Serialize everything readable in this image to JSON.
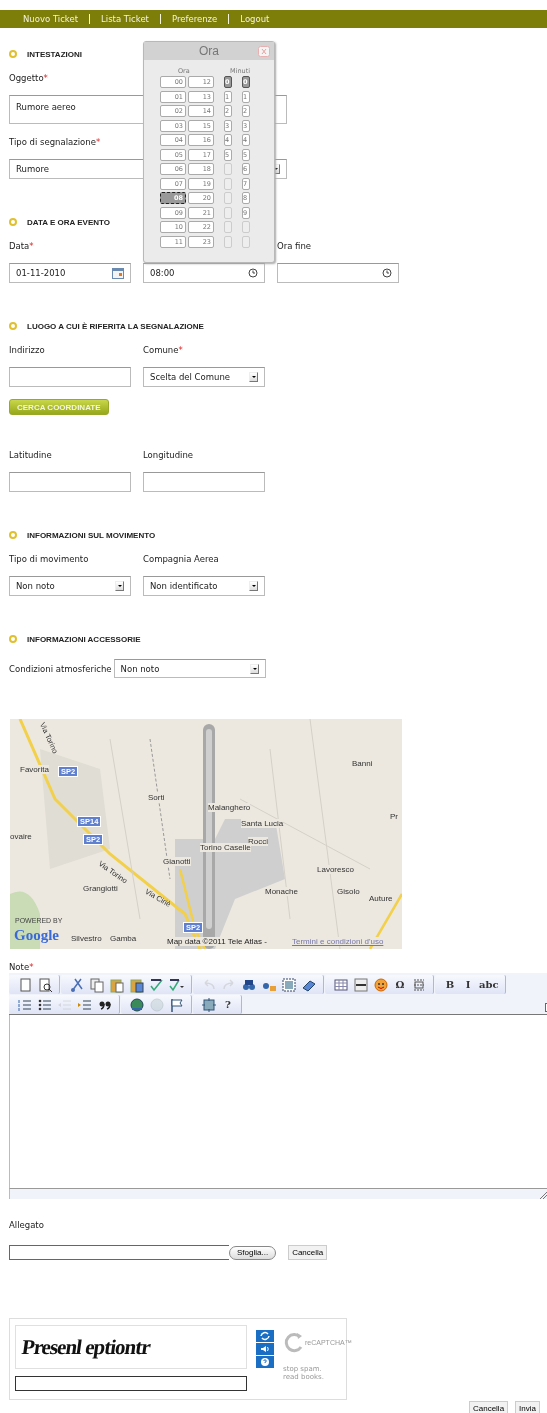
{
  "nav": [
    {
      "label": "Nuovo Ticket"
    },
    {
      "label": "Lista Ticket"
    },
    {
      "label": "Preferenze"
    },
    {
      "label": "Logout"
    }
  ],
  "sections": [
    {
      "title": "INTESTAZIONI",
      "rows": [
        [
          {
            "kind": "textarea",
            "label": "Oggetto",
            "required_mark": "*",
            "value": "Rumore aereo"
          }
        ],
        [
          {
            "kind": "select",
            "wide": true,
            "label": "Tipo di segnalazione",
            "required_mark": "*",
            "value": "Rumore"
          }
        ]
      ]
    },
    {
      "title": "DATA E ORA EVENTO",
      "rows": [
        [
          {
            "kind": "date",
            "label": "Data",
            "required_mark": "*",
            "value": "01-11-2010"
          },
          {
            "kind": "time",
            "value": "08:00"
          },
          {
            "kind": "time",
            "label": "Ora fine"
          }
        ]
      ]
    },
    {
      "title": "LUOGO A CUI È RIFERITA LA SEGNALAZIONE",
      "rows": [
        [
          {
            "kind": "text",
            "label": "Indirizzo"
          },
          {
            "kind": "select",
            "label": "Comune",
            "required_mark": "*",
            "value": "Scelta del Comune"
          }
        ],
        [
          {
            "kind": "button",
            "value": "CERCA COORDINATE"
          }
        ],
        [
          {
            "kind": "text",
            "label": "Latitudine"
          },
          {
            "kind": "text",
            "label": "Longitudine"
          }
        ]
      ]
    },
    {
      "title": "INFORMAZIONI SUL MOVIMENTO",
      "rows": [
        [
          {
            "kind": "select",
            "label": "Tipo di movimento",
            "value": "Non noto"
          },
          {
            "kind": "select",
            "label": "Compagnia Aerea",
            "value": "Non identificato"
          }
        ]
      ]
    },
    {
      "title": "INFORMAZIONI ACCESSORIE",
      "rows": [
        [
          {
            "kind": "inline-select",
            "label": "Condizioni atmosferiche",
            "value": "Non noto"
          }
        ]
      ]
    }
  ],
  "time_picker": {
    "title": "Ora",
    "hours_heading": "Ora",
    "minutes_heading": "Minuti",
    "hours": [
      {
        "label": "00",
        "selected": false
      },
      {
        "label": "01",
        "selected": false
      },
      {
        "label": "02",
        "selected": false
      },
      {
        "label": "03",
        "selected": false
      },
      {
        "label": "04",
        "selected": false
      },
      {
        "label": "05",
        "selected": false
      },
      {
        "label": "06",
        "selected": false
      },
      {
        "label": "07",
        "selected": false
      },
      {
        "label": "08",
        "selected": true
      },
      {
        "label": "09",
        "selected": false
      },
      {
        "label": "10",
        "selected": false
      },
      {
        "label": "11",
        "selected": false
      },
      {
        "label": "12",
        "selected": false
      },
      {
        "label": "13",
        "selected": false
      },
      {
        "label": "14",
        "selected": false
      },
      {
        "label": "15",
        "selected": false
      },
      {
        "label": "16",
        "selected": false
      },
      {
        "label": "17",
        "selected": false
      },
      {
        "label": "18",
        "selected": false
      },
      {
        "label": "19",
        "selected": false
      },
      {
        "label": "20",
        "selected": false
      },
      {
        "label": "21",
        "selected": false
      },
      {
        "label": "22",
        "selected": false
      },
      {
        "label": "23",
        "selected": false
      }
    ],
    "minute_tens": [
      {
        "label": "0",
        "selected": true
      },
      {
        "label": "1",
        "selected": false
      },
      {
        "label": "2",
        "selected": false
      },
      {
        "label": "3",
        "selected": false
      },
      {
        "label": "4",
        "selected": false
      },
      {
        "label": "5",
        "selected": false
      }
    ],
    "minute_units": [
      {
        "label": "0",
        "selected": true
      },
      {
        "label": "1",
        "selected": false
      },
      {
        "label": "2",
        "selected": false
      },
      {
        "label": "3",
        "selected": false
      },
      {
        "label": "4",
        "selected": false
      },
      {
        "label": "5",
        "selected": false
      },
      {
        "label": "6",
        "selected": false
      },
      {
        "label": "7",
        "selected": false
      },
      {
        "label": "8",
        "selected": false
      },
      {
        "label": "9",
        "selected": false
      }
    ]
  },
  "map": {
    "labels": [
      {
        "text": "Favorita",
        "kind": "place"
      },
      {
        "text": "SP2",
        "kind": "road-badge"
      },
      {
        "text": "Sorti",
        "kind": "place"
      },
      {
        "text": "Malanghero",
        "kind": "place"
      },
      {
        "text": "Santa Lucia",
        "kind": "place"
      },
      {
        "text": "Rocci",
        "kind": "place"
      },
      {
        "text": "Torino Caselle",
        "kind": "place"
      },
      {
        "text": "Gianotti",
        "kind": "place"
      },
      {
        "text": "Lavoresco",
        "kind": "place"
      },
      {
        "text": "Grangiotti",
        "kind": "place"
      },
      {
        "text": "Monache",
        "kind": "place"
      },
      {
        "text": "Gisolo",
        "kind": "place"
      },
      {
        "text": "Auture",
        "kind": "place"
      },
      {
        "text": "Banni",
        "kind": "place"
      },
      {
        "text": "SP14",
        "kind": "road-badge"
      },
      {
        "text": "SP2",
        "kind": "road-badge"
      },
      {
        "text": "SP2",
        "kind": "road-badge"
      },
      {
        "text": "Silvestro",
        "kind": "place"
      },
      {
        "text": "Gamba",
        "kind": "place"
      },
      {
        "text": "Via Torino",
        "kind": "road"
      },
      {
        "text": "Via Torino",
        "kind": "road"
      },
      {
        "text": "Via Ciriè",
        "kind": "road"
      },
      {
        "text": "ovaire",
        "kind": "place"
      },
      {
        "text": "Pr",
        "kind": "place"
      }
    ],
    "powered_by": "POWERED BY",
    "logo": "Google",
    "attribution": "Map data ©2011 Tele Atlas - ",
    "terms_link": "Termini e condizioni d'uso"
  },
  "note": {
    "label": "Note",
    "required_mark": "*",
    "toolbar": [
      [
        [
          {
            "kind": "page",
            "disabled": false
          },
          {
            "kind": "preview",
            "disabled": false
          }
        ],
        [
          {
            "kind": "cut",
            "disabled": false
          },
          {
            "kind": "copy",
            "disabled": false
          },
          {
            "kind": "paste",
            "disabled": false
          },
          {
            "kind": "paste-word",
            "disabled": false
          },
          {
            "kind": "spellcheck",
            "disabled": false
          },
          {
            "kind": "spellcheck-menu",
            "disabled": false
          }
        ],
        [
          {
            "kind": "undo",
            "disabled": true
          },
          {
            "kind": "redo",
            "disabled": true
          },
          {
            "kind": "find",
            "disabled": false
          },
          {
            "kind": "replace",
            "disabled": false
          },
          {
            "kind": "select-all",
            "disabled": false
          },
          {
            "kind": "eraser",
            "disabled": false
          }
        ],
        [
          {
            "kind": "table",
            "disabled": false
          },
          {
            "kind": "rule",
            "disabled": false
          },
          {
            "kind": "smiley",
            "disabled": false
          },
          {
            "kind": "char",
            "label": "Ω",
            "disabled": false
          },
          {
            "kind": "page-break",
            "disabled": false
          }
        ],
        [
          {
            "kind": "char",
            "label": "B",
            "disabled": false
          },
          {
            "kind": "char",
            "label": "I",
            "disabled": false
          },
          {
            "kind": "char",
            "label": "abc",
            "disabled": false
          }
        ]
      ],
      [
        [
          {
            "kind": "numbered-list",
            "disabled": false
          },
          {
            "kind": "bullet-list",
            "disabled": false
          },
          {
            "kind": "outdent",
            "disabled": true
          },
          {
            "kind": "indent",
            "disabled": false
          },
          {
            "kind": "quote",
            "disabled": false
          }
        ],
        [
          {
            "kind": "link",
            "disabled": false
          },
          {
            "kind": "unlink",
            "disabled": true
          },
          {
            "kind": "flag",
            "disabled": false
          }
        ],
        [
          {
            "kind": "frame",
            "disabled": false
          },
          {
            "kind": "char",
            "label": "?",
            "disabled": false
          }
        ]
      ]
    ]
  },
  "attachment": {
    "label": "Allegato",
    "browse": "Sfoglia...",
    "clear": "Cancella"
  },
  "captcha": {
    "words": "Presenl eptiontr",
    "logo": "reCAPTCHA™",
    "slogan": "stop spam. read books."
  },
  "buttons": [
    {
      "label": "Cancella"
    },
    {
      "label": "Invia"
    }
  ]
}
